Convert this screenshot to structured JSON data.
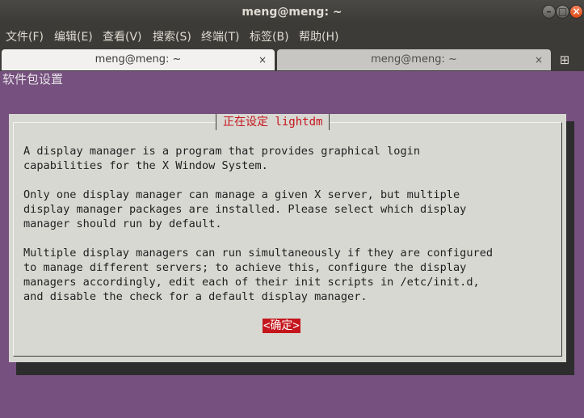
{
  "window": {
    "title": "meng@meng: ~",
    "controls": [
      "–",
      "□",
      "×"
    ]
  },
  "menu": [
    "文件(F)",
    "编辑(E)",
    "查看(V)",
    "搜索(S)",
    "终端(T)",
    "标签(B)",
    "帮助(H)"
  ],
  "tabs": [
    {
      "label": "meng@meng: ~",
      "close": "×"
    },
    {
      "label": "meng@meng: ~",
      "close": "×"
    }
  ],
  "new_tab_glyph": "⊞",
  "terminal": {
    "package_config_title": "软件包设置",
    "dialog": {
      "title": "正在设定 lightdm",
      "paragraphs": [
        "A display manager is a program that provides graphical login\ncapabilities for the X Window System.",
        "Only one display manager can manage a given X server, but multiple\ndisplay manager packages are installed. Please select which display\nmanager should run by default.",
        "Multiple display managers can run simultaneously if they are configured\nto manage different servers; to achieve this, configure the display\nmanagers accordingly, edit each of their init scripts in /etc/init.d,\nand disable the check for a default display manager."
      ],
      "ok_button": "<确定>"
    }
  },
  "colors": {
    "terminal_bg": "#76507e",
    "dialog_bg": "#d8d8d3",
    "accent_red": "#c4161c",
    "titlebar_bg": "#3c3b37"
  }
}
